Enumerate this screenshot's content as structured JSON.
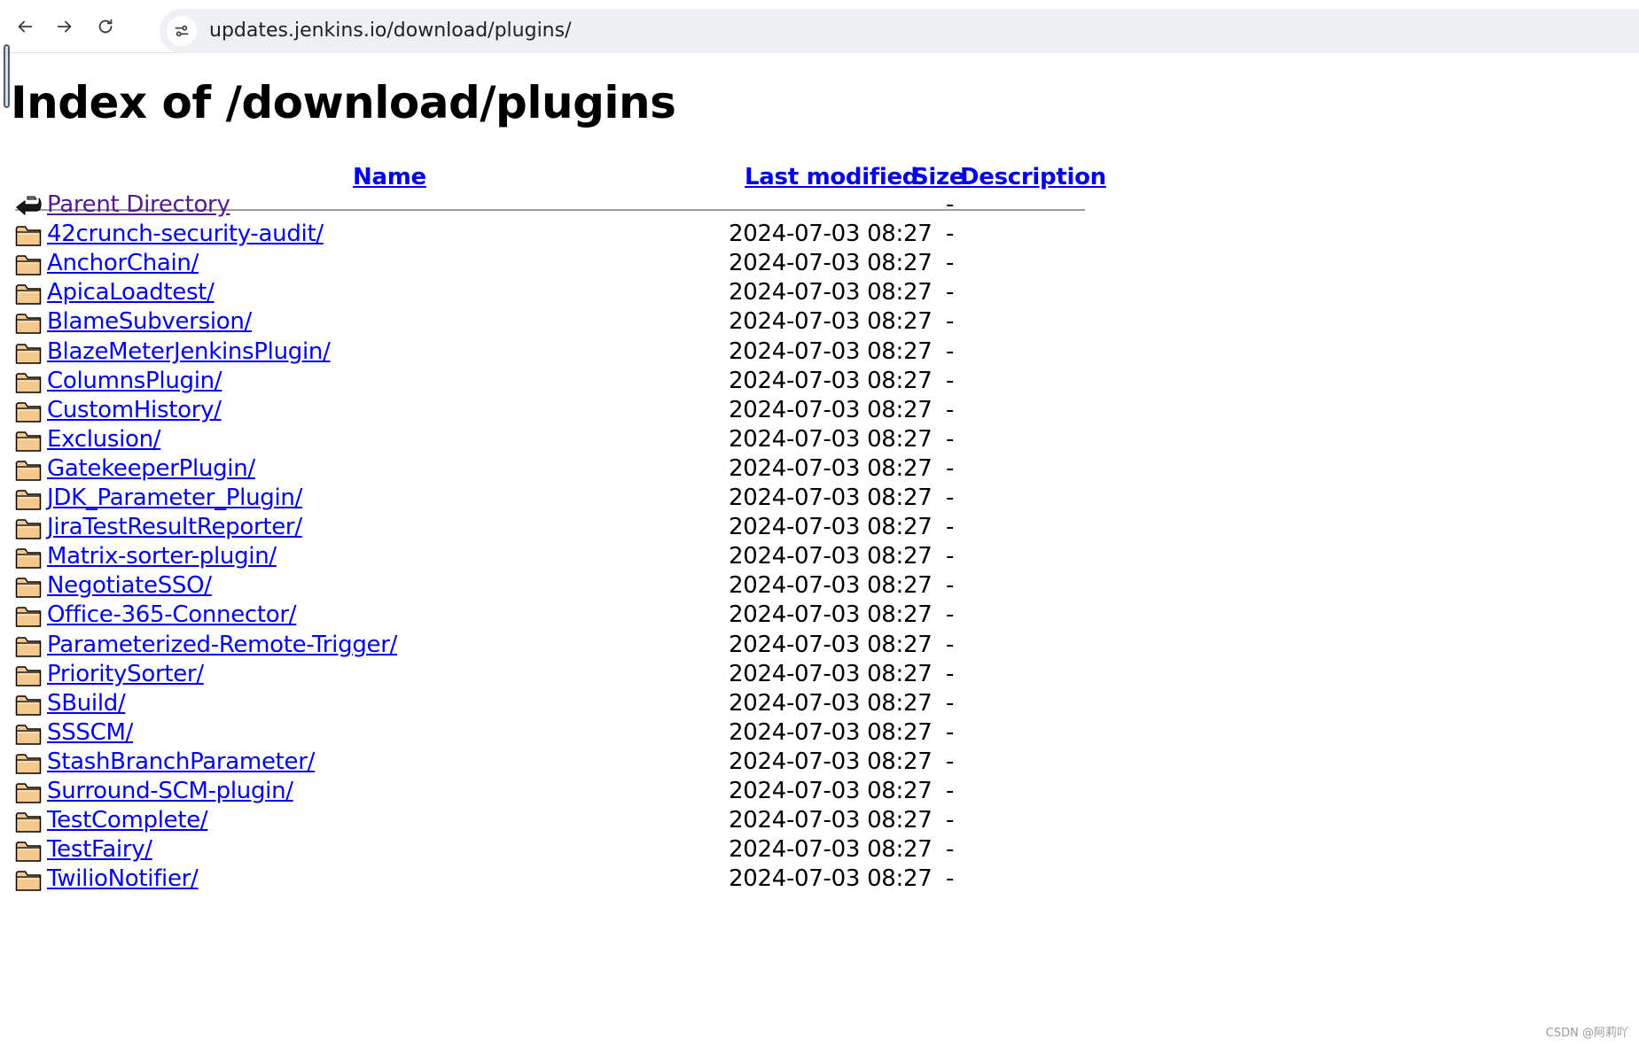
{
  "browser": {
    "url": "updates.jenkins.io/download/plugins/",
    "back_icon": "arrow-left-icon",
    "forward_icon": "arrow-right-icon",
    "reload_icon": "reload-icon",
    "site_info_icon": "tune-icon"
  },
  "page": {
    "title": "Index of /download/plugins"
  },
  "table": {
    "headers": {
      "name": "Name",
      "modified": "Last modified",
      "size": "Size",
      "description": "Description"
    },
    "rows": [
      {
        "icon": "parent-directory-icon",
        "name": "Parent Directory",
        "modified": "",
        "size": "-",
        "visited": true
      },
      {
        "icon": "folder-icon",
        "name": "42crunch-security-audit/",
        "modified": "2024-07-03 08:27",
        "size": "-"
      },
      {
        "icon": "folder-icon",
        "name": "AnchorChain/",
        "modified": "2024-07-03 08:27",
        "size": "-"
      },
      {
        "icon": "folder-icon",
        "name": "ApicaLoadtest/",
        "modified": "2024-07-03 08:27",
        "size": "-"
      },
      {
        "icon": "folder-icon",
        "name": "BlameSubversion/",
        "modified": "2024-07-03 08:27",
        "size": "-"
      },
      {
        "icon": "folder-icon",
        "name": "BlazeMeterJenkinsPlugin/",
        "modified": "2024-07-03 08:27",
        "size": "-"
      },
      {
        "icon": "folder-icon",
        "name": "ColumnsPlugin/",
        "modified": "2024-07-03 08:27",
        "size": "-"
      },
      {
        "icon": "folder-icon",
        "name": "CustomHistory/",
        "modified": "2024-07-03 08:27",
        "size": "-"
      },
      {
        "icon": "folder-icon",
        "name": "Exclusion/",
        "modified": "2024-07-03 08:27",
        "size": "-"
      },
      {
        "icon": "folder-icon",
        "name": "GatekeeperPlugin/",
        "modified": "2024-07-03 08:27",
        "size": "-"
      },
      {
        "icon": "folder-icon",
        "name": "JDK_Parameter_Plugin/",
        "modified": "2024-07-03 08:27",
        "size": "-"
      },
      {
        "icon": "folder-icon",
        "name": "JiraTestResultReporter/",
        "modified": "2024-07-03 08:27",
        "size": "-"
      },
      {
        "icon": "folder-icon",
        "name": "Matrix-sorter-plugin/",
        "modified": "2024-07-03 08:27",
        "size": "-"
      },
      {
        "icon": "folder-icon",
        "name": "NegotiateSSO/",
        "modified": "2024-07-03 08:27",
        "size": "-"
      },
      {
        "icon": "folder-icon",
        "name": "Office-365-Connector/",
        "modified": "2024-07-03 08:27",
        "size": "-"
      },
      {
        "icon": "folder-icon",
        "name": "Parameterized-Remote-Trigger/",
        "modified": "2024-07-03 08:27",
        "size": "-"
      },
      {
        "icon": "folder-icon",
        "name": "PrioritySorter/",
        "modified": "2024-07-03 08:27",
        "size": "-"
      },
      {
        "icon": "folder-icon",
        "name": "SBuild/",
        "modified": "2024-07-03 08:27",
        "size": "-"
      },
      {
        "icon": "folder-icon",
        "name": "SSSCM/",
        "modified": "2024-07-03 08:27",
        "size": "-"
      },
      {
        "icon": "folder-icon",
        "name": "StashBranchParameter/",
        "modified": "2024-07-03 08:27",
        "size": "-"
      },
      {
        "icon": "folder-icon",
        "name": "Surround-SCM-plugin/",
        "modified": "2024-07-03 08:27",
        "size": "-"
      },
      {
        "icon": "folder-icon",
        "name": "TestComplete/",
        "modified": "2024-07-03 08:27",
        "size": "-"
      },
      {
        "icon": "folder-icon",
        "name": "TestFairy/",
        "modified": "2024-07-03 08:27",
        "size": "-"
      },
      {
        "icon": "folder-icon",
        "name": "TwilioNotifier/",
        "modified": "2024-07-03 08:27",
        "size": "-"
      }
    ]
  },
  "watermark": "CSDN @阿莉吖",
  "colors": {
    "link": "#0000ee",
    "visited_link": "#551a8b",
    "folder_fill": "#f5c98b",
    "rule": "#9c9c9c"
  }
}
